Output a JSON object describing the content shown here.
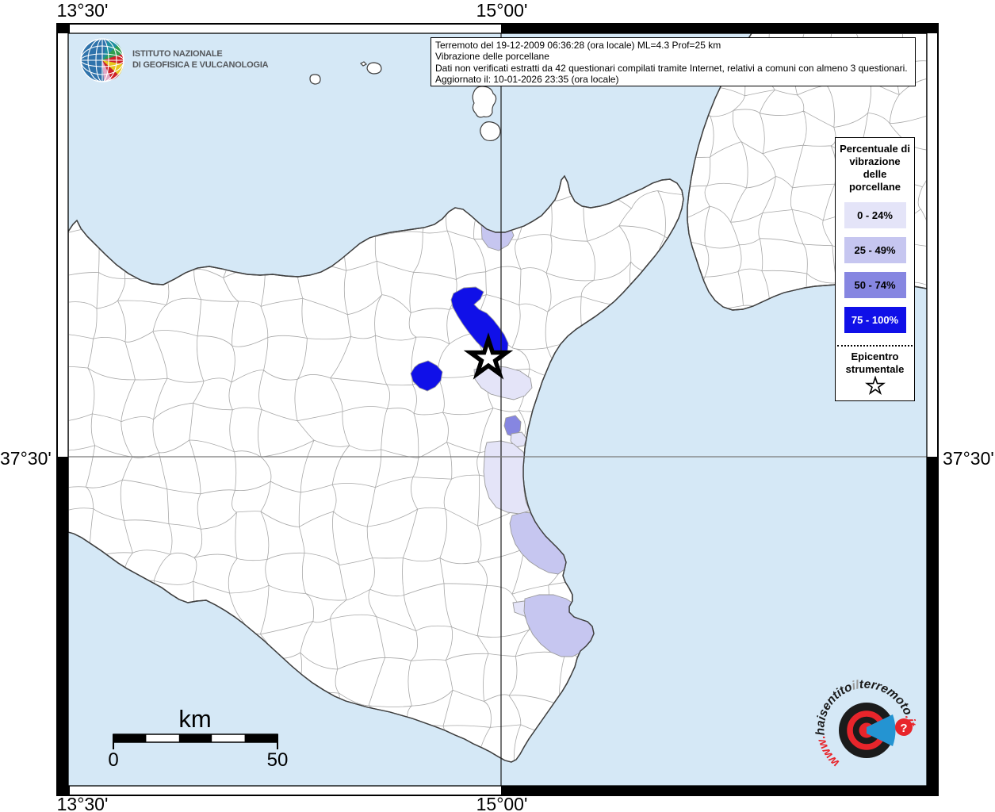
{
  "coordinates": {
    "top_left_lon": "13°30'",
    "top_center_lon": "15°00'",
    "bottom_left_lon": "13°30'",
    "bottom_center_lon": "15°00'",
    "left_lat": "37°30'",
    "right_lat": "37°30'"
  },
  "branding": {
    "institute_line1": "ISTITUTO NAZIONALE",
    "institute_line2": "DI GEOFISICA E VULCANOLOGIA"
  },
  "info_box": {
    "line1": "Terremoto del 19-12-2009 06:36:28 (ora locale) ML=4.3 Prof=25 km",
    "line2": "Vibrazione delle porcellane",
    "line3": "Dati non verificati estratti da 42 questionari compilati tramite Internet, relativi a comuni con almeno 3 questionari.",
    "line4": "Aggiornato il: 10-01-2026 23:35 (ora locale)"
  },
  "legend": {
    "title": "Percentuale di vibrazione delle porcellane",
    "items": [
      {
        "label": "0 - 24%",
        "color": "#e4e4f8",
        "text_color": "#000000"
      },
      {
        "label": "25 - 49%",
        "color": "#c6c6f0",
        "text_color": "#000000"
      },
      {
        "label": "50 - 74%",
        "color": "#8686e1",
        "text_color": "#000000"
      },
      {
        "label": "75 - 100%",
        "color": "#1010e8",
        "text_color": "#ffffff"
      }
    ],
    "epicenter_title": "Epicentro strumentale"
  },
  "scale_bar": {
    "unit": "km",
    "start_label": "0",
    "end_label": "50"
  },
  "map": {
    "sea_color": "#d5e8f6",
    "land_color": "#ffffff",
    "municipality_border_color": "#a8a8a8",
    "coastline_color": "#3f3f3f",
    "meridian_line": "15°00'",
    "parallel_line": "37°30'"
  },
  "watermark": {
    "prefix": "www.",
    "part1": "haisentito",
    "part2": "il",
    "part3": "terremoto",
    "suffix": ".it",
    "question_mark": "?",
    "red_color": "#e8252b",
    "dark_color": "#1a1a1a",
    "gray_color": "#9a9a9a",
    "blue_color": "#2494d2"
  }
}
